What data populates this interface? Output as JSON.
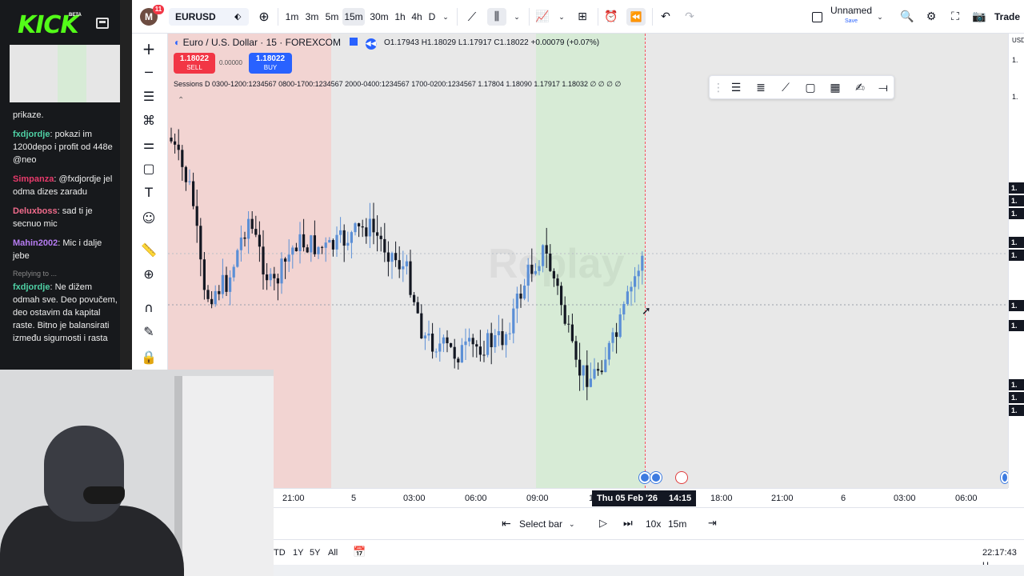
{
  "kick": {
    "logo": "KICK",
    "beta": "BETA",
    "chat": [
      {
        "user": "",
        "text": "prikaze.",
        "color": "#eeeeee"
      },
      {
        "user": "fxdjordje",
        "text": ": pokazi im 1200depo i profit od 448e @neo",
        "color": "#4fd1a5"
      },
      {
        "user": "Simpanza",
        "text": ": @fxdjordje jel odma dizes zaradu",
        "color": "#e83a6b"
      },
      {
        "user": "Deluxboss",
        "text": ": sad ti je secnuo mic",
        "color": "#f06b8b"
      },
      {
        "user": "Mahin2002",
        "text": ": Mic i dalje jebe",
        "color": "#b67cf2"
      },
      {
        "user": "fxdjordje",
        "text": ": Ne dižem odmah sve. Deo povučem, deo ostavim da kapital raste. Bitno je balansirati između sigurnosti i rasta",
        "color": "#4fd1a5",
        "reply": "Replying to ..."
      }
    ]
  },
  "toolbar": {
    "avatar_letter": "M",
    "notification_count": "11",
    "symbol": "EURUSD",
    "intervals": [
      "1m",
      "3m",
      "5m",
      "15m",
      "30m",
      "1h",
      "4h",
      "D"
    ],
    "active_interval": "15m",
    "layout_name": "Unnamed",
    "layout_status": "Save",
    "trade_label": "Trade"
  },
  "legend": {
    "title": "Euro / U.S. Dollar · 15 · FOREXCOM",
    "ohlc": "O1.17943 H1.18029 L1.17917 C1.18022 +0.00079 (+0.07%)",
    "sell_price": "1.18022",
    "sell_label": "SELL",
    "spread": "0.00000",
    "buy_price": "1.18022",
    "buy_label": "BUY",
    "sessions": "Sessions D 0300-1200:1234567 0800-1700:1234567 2000-0400:1234567 1700-0200:1234567  1.17804  1.18090  1.17917  1.18032  ∅  ∅  ∅  ∅"
  },
  "watermark": "Replay",
  "price_scale": {
    "currency": "USD",
    "labels": [
      "1.",
      "1.",
      "1.",
      "1.",
      "1.",
      "1.",
      "1.",
      "1.",
      "1.",
      "1.",
      "1.",
      "1."
    ]
  },
  "time_axis": {
    "ticks": [
      "21:00",
      "5",
      "03:00",
      "06:00",
      "09:00",
      "1",
      "18:00",
      "21:00",
      "6",
      "03:00",
      "06:00"
    ],
    "cursor_date": "Thu 05 Feb '26",
    "cursor_time": "14:15"
  },
  "replay": {
    "select_bar": "Select bar",
    "speed": "10x",
    "interval": "15m"
  },
  "bottom": {
    "ranges": [
      "TD",
      "1Y",
      "5Y",
      "All"
    ],
    "clock": "22:17:43 U"
  },
  "colors": {
    "sell": "#f23645",
    "buy": "#2962ff",
    "candle_up": "#5b8fd6",
    "candle_down": "#131722",
    "session_red": "#f2d4d2",
    "session_green": "#d7ebd6"
  }
}
